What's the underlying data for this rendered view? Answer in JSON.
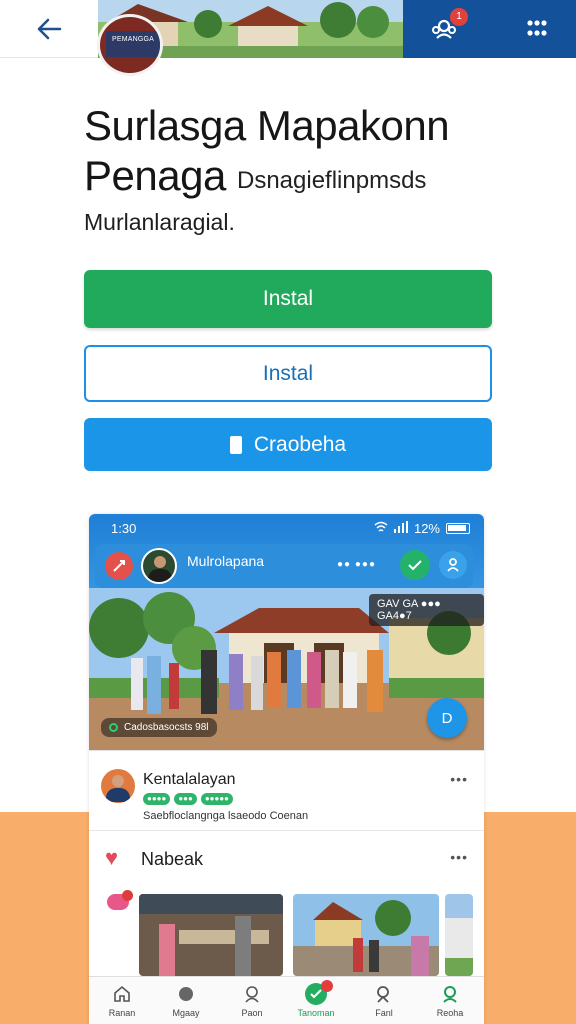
{
  "topbar": {
    "back_icon": "arrow-left-icon",
    "logo_text": "PEMANGGA",
    "notification_count": "1",
    "notification_icon": "community-icon",
    "menu_icon": "grid-icon"
  },
  "headline": {
    "line1": "Surlasga Mapakonn",
    "line2": "Penaga",
    "line2_aside": "Dsnagieflinpmsds",
    "subtitle": "Murlanlaragial."
  },
  "actions": {
    "primary_label": "Instal",
    "outline_label": "Instal",
    "blue_label": "Craobeha"
  },
  "preview": {
    "status_time": "1:30",
    "status_battery": "12%",
    "header_name": "Mulrolapana",
    "header_dots": "●● ●●●",
    "scene_tag": "GAV GA ●●● GA4●7",
    "scene_caption": "Cadosbasocsts 98l",
    "fab_label": "D",
    "post": {
      "name": "Kentalalayan",
      "chips": [
        "●●●●",
        "●●●",
        "●●●●●"
      ],
      "text": "Saebfloclangnga lsaeodo Coenan"
    },
    "section": {
      "label": "Nabeak"
    },
    "nav": [
      {
        "label": "Ranan",
        "icon": "home-icon"
      },
      {
        "label": "Mgaay",
        "icon": "globe-icon"
      },
      {
        "label": "Paon",
        "icon": "people-icon"
      },
      {
        "label": "Tanoman",
        "icon": "check-icon"
      },
      {
        "label": "Fanl",
        "icon": "search-icon"
      },
      {
        "label": "Reoha",
        "icon": "profile-icon"
      }
    ]
  },
  "colors": {
    "primary_green": "#22aa5c",
    "accent_blue": "#1b95e8",
    "dark_blue": "#14519b",
    "peach": "#f8ae6a"
  }
}
